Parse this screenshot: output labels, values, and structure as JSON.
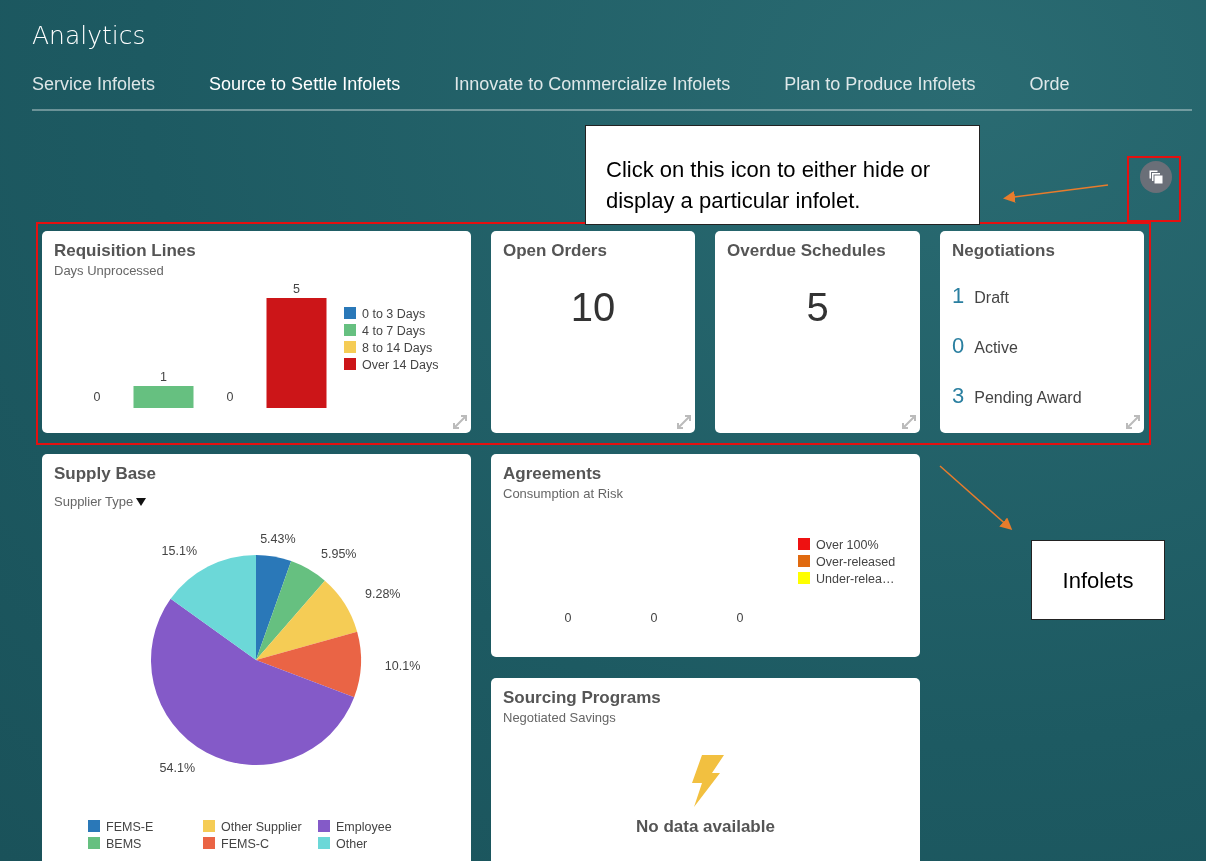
{
  "header": {
    "title": "Analytics"
  },
  "tabs": [
    {
      "label": "Service Infolets",
      "selected": false
    },
    {
      "label": "Source to Settle Infolets",
      "selected": true
    },
    {
      "label": "Innovate to Commercialize Infolets",
      "selected": false
    },
    {
      "label": "Plan to Produce Infolets",
      "selected": false
    },
    {
      "label": "Orde",
      "selected": false
    }
  ],
  "infolets": [
    {
      "kind": "legend",
      "title": "Requisition Lines",
      "subtitle": "Days Unprocessed",
      "readings": [
        "0",
        "1",
        "0",
        "5"
      ],
      "legend": [
        {
          "label": "0 to 3 Days",
          "color": "#2a78b8"
        },
        {
          "label": "4 to 7 Days",
          "color": "#66c080"
        },
        {
          "label": "8 to 14 Days",
          "color": "#f5cc55"
        },
        {
          "label": "Over 14 Days",
          "color": "#cc1518"
        }
      ]
    },
    {
      "kind": "count",
      "title": "Open Orders",
      "value": "10"
    },
    {
      "kind": "count",
      "title": "Overdue Schedules",
      "value": "5"
    },
    {
      "kind": "list",
      "title": "Negotiations",
      "items": [
        {
          "count": "1",
          "label": "Draft"
        },
        {
          "count": "0",
          "label": "Active"
        },
        {
          "count": "3",
          "label": "Pending Award"
        }
      ]
    },
    {
      "kind": "chart",
      "title": "Supply Base",
      "filter": "Supplier Type",
      "chart_data": {
        "type": "pie",
        "categories": [
          "FEMS-E",
          "BEMS",
          "Other Supplier",
          "FEMS-C",
          "Employee",
          "Other"
        ],
        "colors": [
          "#2a78b8",
          "#66c080",
          "#f5cc55",
          "#ea6445",
          "#845ac8",
          "#6cd8d8"
        ],
        "values": [
          5.43,
          5.95,
          9.28,
          10.1,
          54.1,
          15.1
        ],
        "value_labels": [
          "5.43%",
          "5.95%",
          "9.28%",
          "10.1%",
          "54.1%",
          "15.1%"
        ],
        "legend": "bottom"
      }
    },
    {
      "kind": "legend",
      "title": "Agreements",
      "subtitle": "Consumption at Risk",
      "readings": [
        "0",
        "0",
        "0"
      ],
      "legend": [
        {
          "label": "Over 100%",
          "color": "#ee1111"
        },
        {
          "label": "Over-released",
          "color": "#e06a10"
        },
        {
          "label": "Under-relea…",
          "color": "#ffff00"
        }
      ]
    },
    {
      "kind": "empty",
      "title": "Sourcing Programs",
      "subtitle": "Negotiated Savings",
      "message": "No data available"
    }
  ],
  "annotations": [
    {
      "text": "Click on this icon to either hide or display a particular infolet."
    },
    {
      "text": "Infolets"
    }
  ]
}
